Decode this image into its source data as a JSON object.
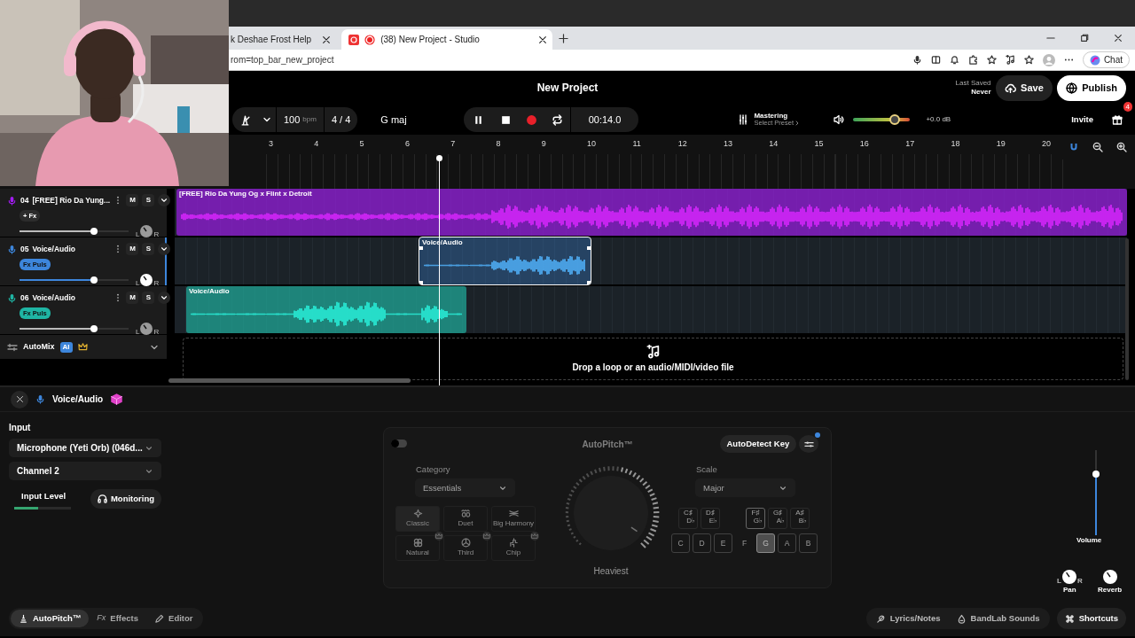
{
  "browser": {
    "tabs": [
      {
        "title": "k Deshae Frost Help",
        "selected": false,
        "kind": "page"
      },
      {
        "title": "(38) New Project - Studio",
        "selected": true,
        "kind": "studio"
      }
    ],
    "address": "rom=top_bar_new_project",
    "chat": "Chat"
  },
  "header": {
    "title": "New Project",
    "last_saved_label": "Last Saved",
    "last_saved_value": "Never",
    "save": "Save",
    "publish": "Publish"
  },
  "toolbar": {
    "tempo": "100",
    "tempo_unit": "bpm",
    "time_signature": "4 / 4",
    "key": "G maj",
    "playing": true,
    "time": "00:14.0",
    "mastering_title": "Mastering",
    "mastering_preset": "Select Preset",
    "master_volume": {
      "level": 0.73
    },
    "gain": "+0.0 dB",
    "invite": "Invite",
    "gift_badge": "4"
  },
  "ruler": {
    "bars": [
      "3",
      "4",
      "5",
      "6",
      "7",
      "8",
      "9",
      "10",
      "11",
      "12",
      "13",
      "14",
      "15",
      "16",
      "17",
      "18",
      "19",
      "20"
    ],
    "snap": true
  },
  "tracks": [
    {
      "number": "04",
      "name": "[FREE] Rio Da Yung...",
      "color": "#a21cf0",
      "selected": false,
      "fx": {
        "kind": "add",
        "label": "+ Fx"
      },
      "mute": "M",
      "solo": "S",
      "volume": {
        "level": 0.68
      },
      "pan_left": "L",
      "pan_right": "R",
      "clip": {
        "label": "[FREE] Rio Da Yung Og x Flint x Detroit",
        "selected": false
      }
    },
    {
      "number": "05",
      "name": "Voice/Audio",
      "color": "#3d86dc",
      "selected": true,
      "fx": {
        "kind": "plugin",
        "label": "Fx Puls"
      },
      "mute": "M",
      "solo": "S",
      "volume": {
        "level": 0.68
      },
      "pan_left": "L",
      "pan_right": "R",
      "clip": {
        "label": "Voice/Audio",
        "selected": true
      }
    },
    {
      "number": "06",
      "name": "Voice/Audio",
      "color": "#1fb5a4",
      "selected": false,
      "fx": {
        "kind": "plugin",
        "label": "Fx Puls"
      },
      "mute": "M",
      "solo": "S",
      "volume": {
        "level": 0.68
      },
      "pan_left": "L",
      "pan_right": "R",
      "clip": {
        "label": "Voice/Audio",
        "selected": false
      }
    }
  ],
  "automix": {
    "label": "AutoMix",
    "badge": "AI"
  },
  "drop_zone": {
    "text": "Drop a loop or an audio/MIDI/video file"
  },
  "editor": {
    "title": "Voice/Audio",
    "input": {
      "label": "Input",
      "device": "Microphone (Yeti Orb) (046d...",
      "channel": "Channel 2",
      "level_label": "Input Level",
      "input_level": {
        "level": 0.42
      },
      "monitoring": "Monitoring"
    },
    "autopitch": {
      "enabled": false,
      "title": "AutoPitch™",
      "autodetect": "AutoDetect Key",
      "settings_notification": true,
      "category_label": "Category",
      "category": "Essentials",
      "presets": [
        {
          "label": "Classic",
          "selected": true,
          "premium": false,
          "kind": "sparkle"
        },
        {
          "label": "Duet",
          "selected": false,
          "premium": false,
          "kind": "duet"
        },
        {
          "label": "Big Harmony",
          "selected": false,
          "premium": false,
          "kind": "harmony"
        },
        {
          "label": "Natural",
          "selected": false,
          "premium": true,
          "kind": "natural"
        },
        {
          "label": "Third",
          "selected": false,
          "premium": true,
          "kind": "third"
        },
        {
          "label": "Chip",
          "selected": false,
          "premium": true,
          "kind": "chip"
        }
      ],
      "strength_label": "Heaviest",
      "scale_label": "Scale",
      "scale": "Major",
      "black_keys": [
        {
          "sharp": "C♯",
          "flat": "D♭",
          "in_scale": false
        },
        {
          "sharp": "D♯",
          "flat": "E♭",
          "in_scale": false
        },
        {
          "sharp": "F♯",
          "flat": "G♭",
          "in_scale": true
        },
        {
          "sharp": "G♯",
          "flat": "A♭",
          "in_scale": false
        },
        {
          "sharp": "A♯",
          "flat": "B♭",
          "in_scale": false
        }
      ],
      "white_keys": [
        {
          "label": "C",
          "in_scale": true,
          "selected": false
        },
        {
          "label": "D",
          "in_scale": true,
          "selected": false
        },
        {
          "label": "E",
          "in_scale": true,
          "selected": false
        },
        {
          "label": "F",
          "in_scale": false,
          "selected": false
        },
        {
          "label": "G",
          "in_scale": true,
          "selected": true
        },
        {
          "label": "A",
          "in_scale": true,
          "selected": false
        },
        {
          "label": "B",
          "in_scale": true,
          "selected": false
        }
      ]
    },
    "mixer": {
      "volume": {
        "level": 0.72
      },
      "volume_label": "Volume",
      "pan_left": "L",
      "pan_right": "R",
      "pan_label": "Pan",
      "reverb_label": "Reverb"
    }
  },
  "bottom_tabs": [
    {
      "label": "AutoPitch™",
      "selected": true,
      "kind": "pitch"
    },
    {
      "label": "Effects",
      "selected": false,
      "kind": "fx",
      "glyph": "Fx"
    },
    {
      "label": "Editor",
      "selected": false,
      "kind": "pencil"
    }
  ],
  "bottom_actions": [
    {
      "label": "Lyrics/Notes",
      "kind": "feather"
    },
    {
      "label": "BandLab Sounds",
      "kind": "drop"
    },
    {
      "label": "Shortcuts",
      "kind": "command"
    }
  ]
}
